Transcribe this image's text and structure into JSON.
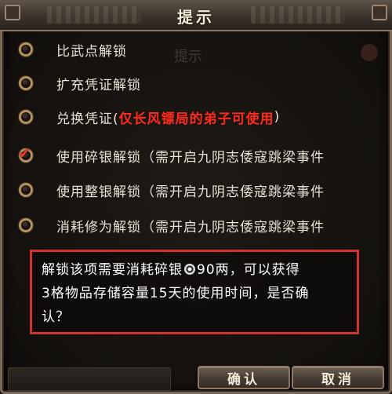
{
  "dialog": {
    "title": "提示",
    "ghost_title": "提示"
  },
  "options": [
    {
      "label": "比武点解锁",
      "checked": false
    },
    {
      "label": "扩充凭证解锁",
      "checked": false
    },
    {
      "label_prefix": "兑换凭证(",
      "label_highlight": "仅长风镖局的弟子可使用",
      "label_suffix": ")",
      "checked": false
    },
    {
      "label": "使用碎银解锁（需开启九阴志倭寇跳梁事件",
      "checked": true
    },
    {
      "label": "使用整银解锁（需开启九阴志倭寇跳梁事件",
      "checked": false
    },
    {
      "label": "消耗修为解锁（需开启九阴志倭寇跳梁事件",
      "checked": false
    }
  ],
  "message": {
    "line1_prefix": "解锁该项需要消耗碎银",
    "line1_suffix": "90两，可以获得",
    "line2": "3格物品存储容量15天的使用时间，是否确",
    "line3": "认？",
    "coin_icon": "silver-coin-icon"
  },
  "buttons": {
    "confirm_label": "确认",
    "cancel_label": "取消"
  },
  "colors": {
    "highlight_red": "#ff2a1a",
    "box_border_red": "#d4302c",
    "text": "#e9e2d6"
  }
}
